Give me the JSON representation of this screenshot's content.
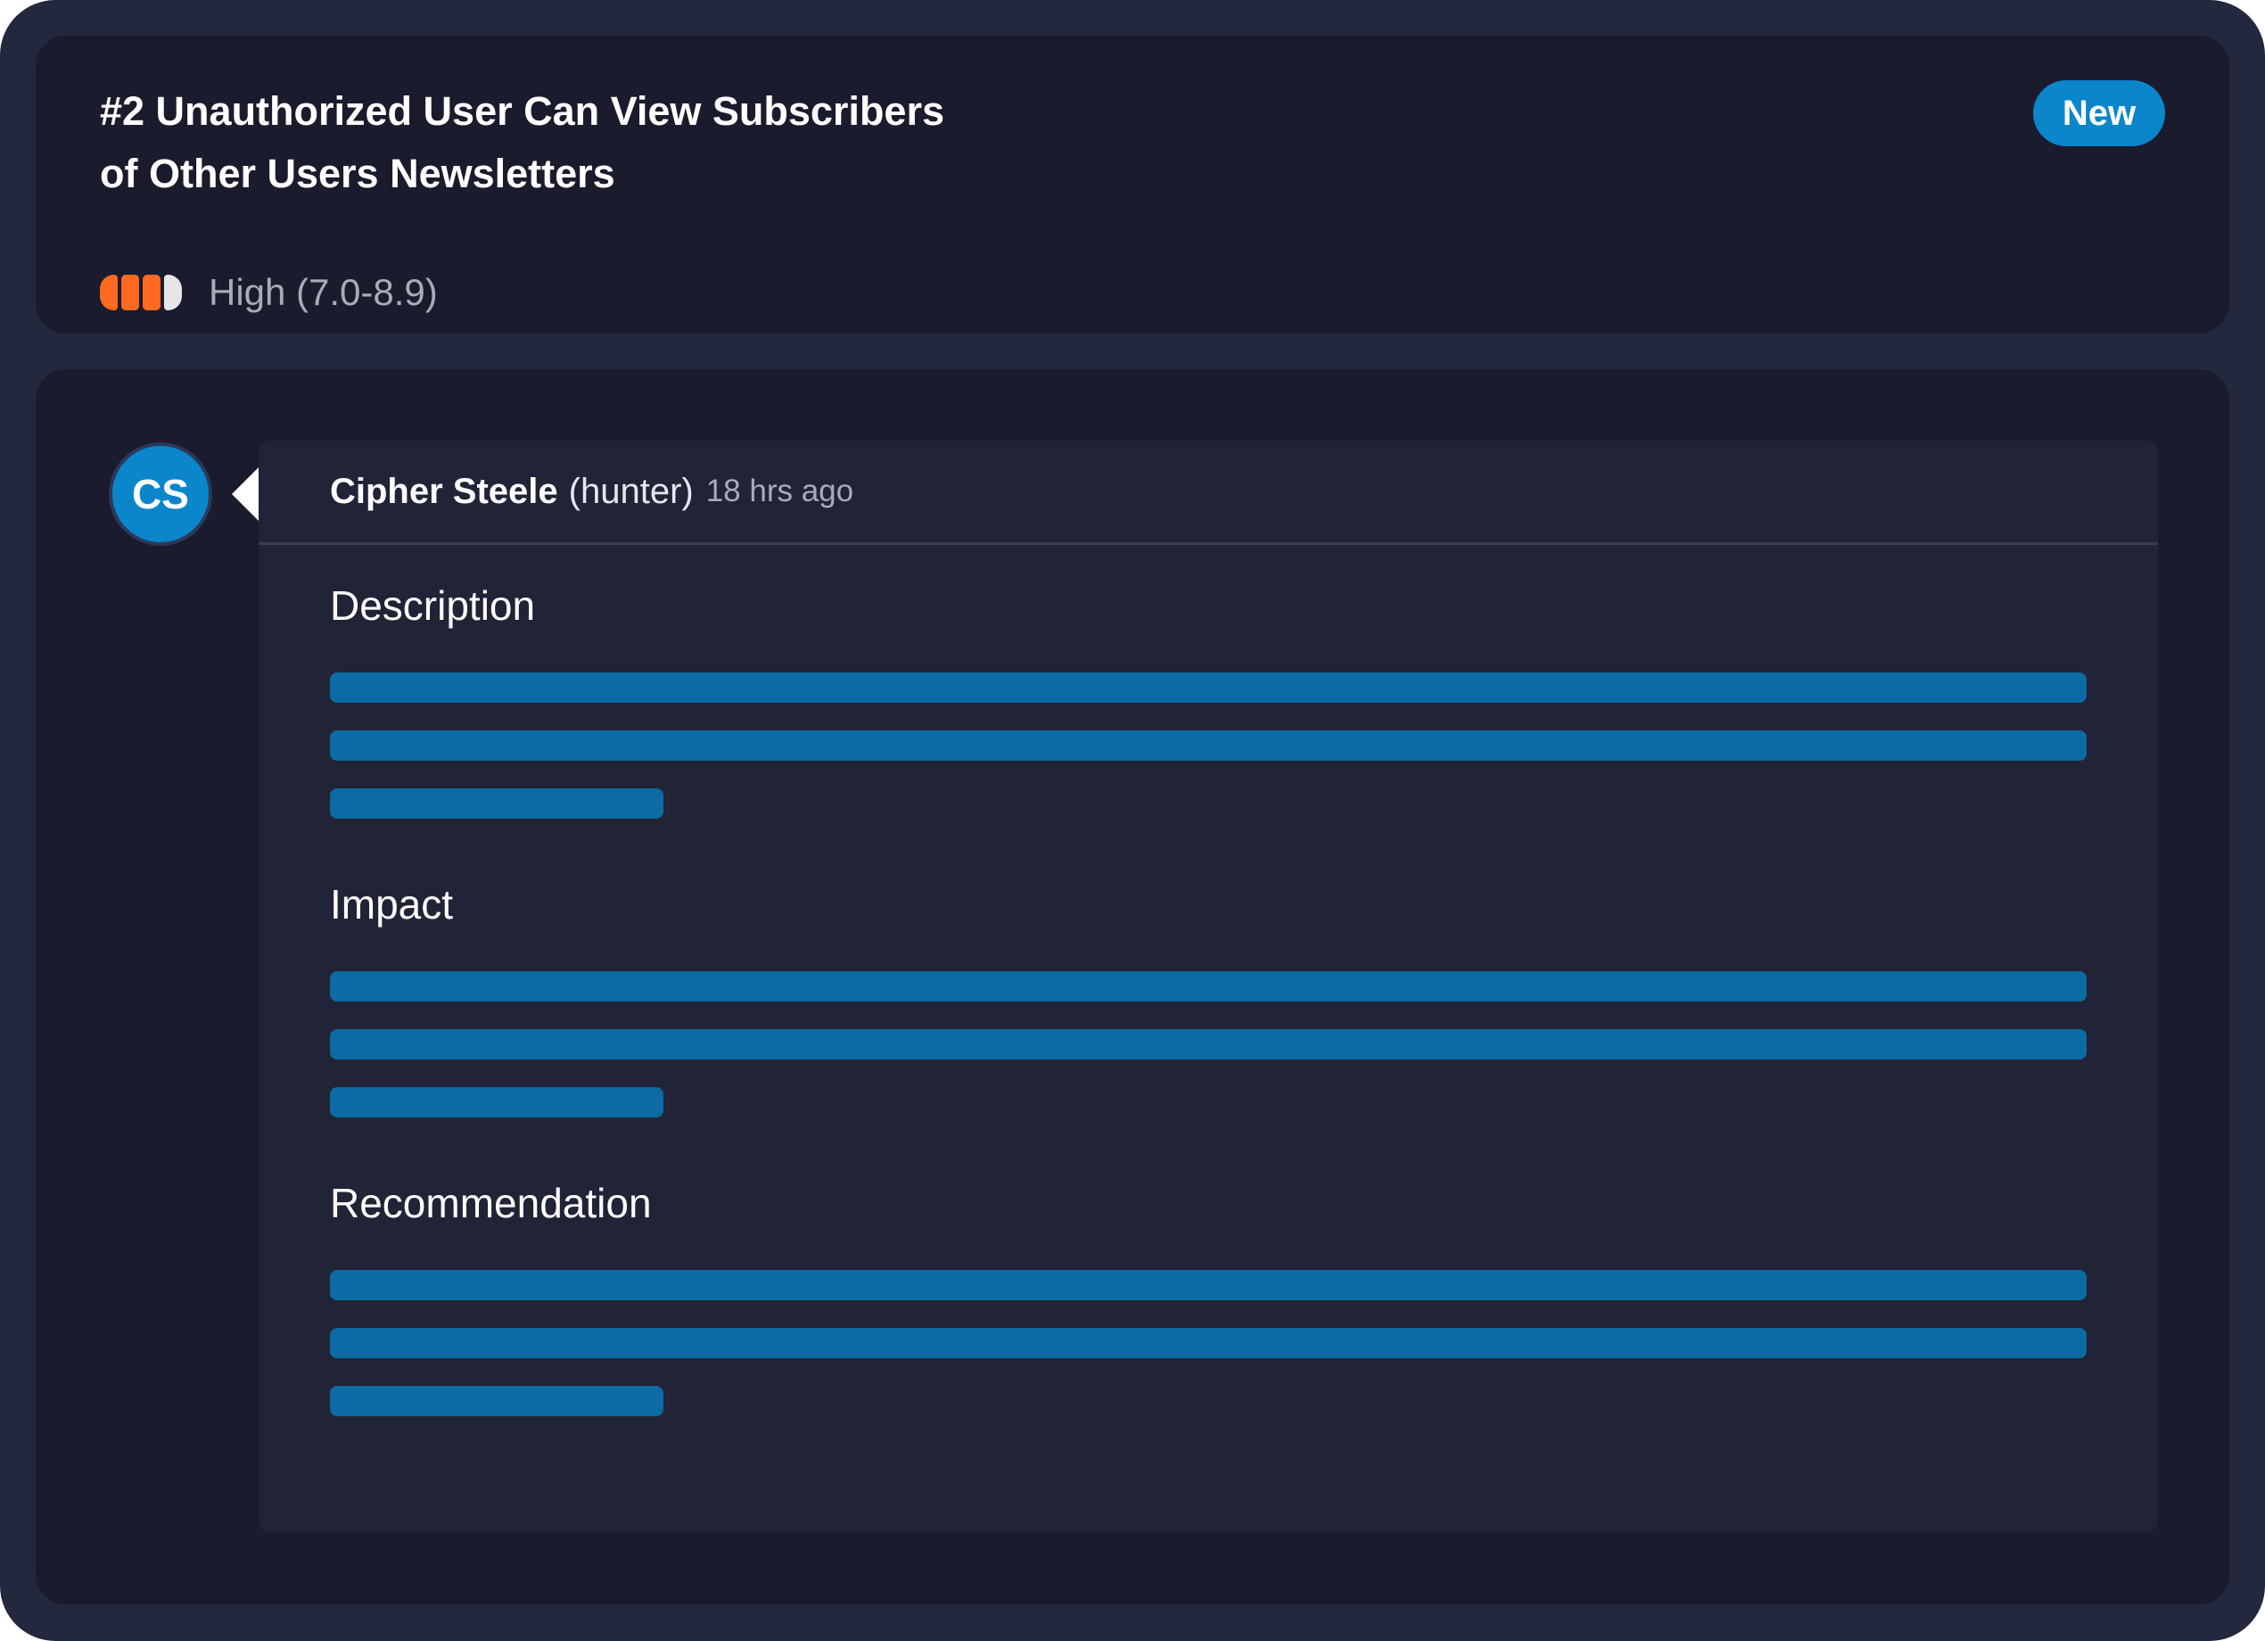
{
  "report": {
    "title_line1": "#2 Unauthorized User Can View Subscribers",
    "title_line2": "of Other Users Newsletters",
    "status_badge": "New",
    "severity": {
      "label": "High (7.0-8.9)",
      "level": 3,
      "max_level": 4,
      "active_color": "#ff6a20",
      "inactive_color": "#e6e6ea"
    }
  },
  "comment": {
    "avatar_initials": "CS",
    "author_name": "Cipher Steele",
    "author_role": "(hunter)",
    "timestamp": "18 hrs ago",
    "sections": [
      {
        "heading": "Description"
      },
      {
        "heading": "Impact"
      },
      {
        "heading": "Recommendation"
      }
    ]
  },
  "colors": {
    "accent": "#0b86cb",
    "placeholder_line": "#0b6ba2",
    "card_bg": "#1a1b2d",
    "frame_bg": "#23283e"
  }
}
